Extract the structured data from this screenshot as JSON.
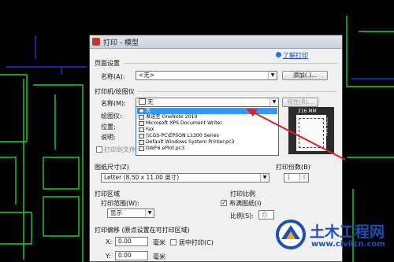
{
  "dialog": {
    "title": "打印 - 模型",
    "learn_link": "了解打印",
    "page_setup": {
      "group_label": "页面设置",
      "name_label": "名称(A):",
      "name_value": "<无>",
      "add_button": "添加(.)..."
    },
    "printer": {
      "group_label": "打印机/绘图仪",
      "name_label": "名称(M):",
      "name_value": "无",
      "properties_button": "特性(R)...",
      "plotter_label": "绘图仪:",
      "location_label": "位置:",
      "desc_label": "说明:",
      "print_to_file_label": "打印到文件(F)",
      "options": [
        "无",
        "发送至 OneNote 2010",
        "Microsoft XPS Document Writer",
        "Fax",
        "\\\\CGS-PC\\EPSON L1300 Series",
        "Default Windows System Printer.pc3",
        "DWF6 ePlot.pc3"
      ],
      "selected_index": 0
    },
    "preview": {
      "width_label": "216 MM",
      "height_label": "279 MM"
    },
    "paper_size": {
      "label": "图纸尺寸(Z)",
      "value": "Letter (8.50 x 11.00 英寸)"
    },
    "copies": {
      "label": "打印份数(B)",
      "value": "1"
    },
    "plot_area": {
      "label": "打印区域",
      "range_label": "打印范围(W):",
      "range_value": "显示"
    },
    "plot_scale": {
      "label": "打印比例",
      "fit_label": "布满图纸(I)",
      "fit_checked": true,
      "scale_label": "比例(S):",
      "scale_value": "自"
    },
    "plot_offset": {
      "label": "打印偏移 (原点设置在可打印区域)",
      "x_label": "X:",
      "x_value": "0.00",
      "y_label": "Y:",
      "y_value": "0.00",
      "unit": "毫米",
      "center_label": "居中打印(C)"
    }
  },
  "watermark": {
    "title": "土木工程网",
    "url": "www.civilcn.com"
  },
  "colors": {
    "cad_green": "#1fd12a",
    "cad_blue": "#1f3cff",
    "highlight": "#3399ff",
    "arrow_red": "#e02020",
    "watermark_blue": "#1b4fb8"
  }
}
